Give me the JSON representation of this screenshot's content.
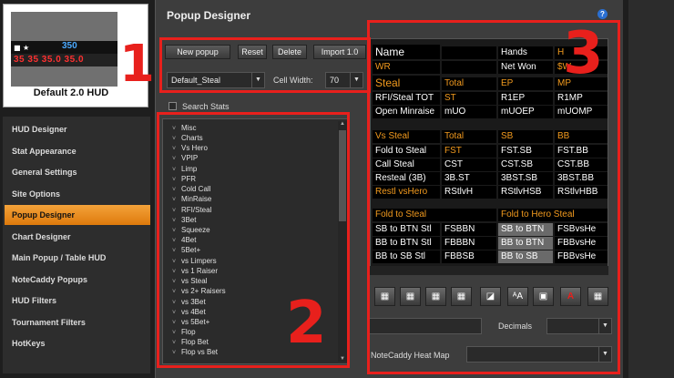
{
  "hud_preview": {
    "stat_value_top": "350",
    "stat_values_bottom": "35 35 35.0 35.0",
    "caption": "Default 2.0 HUD"
  },
  "sidebar": {
    "items": [
      {
        "label": "HUD Designer"
      },
      {
        "label": "Stat Appearance"
      },
      {
        "label": "General Settings"
      },
      {
        "label": "Site Options"
      },
      {
        "label": "Popup Designer"
      },
      {
        "label": "Chart Designer"
      },
      {
        "label": "Main Popup / Table HUD"
      },
      {
        "label": "NoteCaddy Popups"
      },
      {
        "label": "HUD Filters"
      },
      {
        "label": "Tournament Filters"
      },
      {
        "label": "HotKeys"
      }
    ],
    "active_index": 4
  },
  "panel": {
    "title": "Popup Designer",
    "help_icon": "?",
    "buttons": {
      "new_popup": "New popup",
      "reset": "Reset",
      "delete": "Delete",
      "import": "Import 1.0"
    },
    "popup_select": {
      "value": "Default_Steal"
    },
    "cell_width": {
      "label": "Cell Width:",
      "value": "70"
    },
    "search_stats": {
      "label": "Search Stats"
    },
    "decimals": {
      "label": "Decimals"
    },
    "heatmap": {
      "label": "NoteCaddy Heat Map"
    }
  },
  "stat_list": [
    "Misc",
    "Charts",
    "Vs Hero",
    "VPIP",
    "Limp",
    "PFR",
    "Cold Call",
    "MinRaise",
    "RFI/Steal",
    "3Bet",
    "Squeeze",
    "4Bet",
    "5Bet+",
    "vs Limpers",
    "vs 1 Raiser",
    "vs Steal",
    "vs 2+ Raisers",
    "vs 3Bet",
    "vs 4Bet",
    "vs 5Bet+",
    "Flop",
    "Flop Bet",
    "Flop vs Bet"
  ],
  "grid": {
    "rows": [
      [
        "Name",
        "",
        "Hands",
        "H"
      ],
      [
        "WR",
        "",
        "Net Won",
        "$W"
      ],
      [
        "Steal",
        "Total",
        "EP",
        "MP"
      ],
      [
        "RFI/Steal TOT",
        "ST",
        "R1EP",
        "R1MP"
      ],
      [
        "Open Minraise",
        "mUO",
        "mUOEP",
        "mUOMP"
      ],
      [
        "Vs Steal",
        "Total",
        "SB",
        "BB"
      ],
      [
        "Fold to Steal",
        "FST",
        "FST.SB",
        "FST.BB"
      ],
      [
        "Call Steal",
        "CST",
        "CST.SB",
        "CST.BB"
      ],
      [
        "Resteal (3B)",
        "3B.ST",
        "3BST.SB",
        "3BST.BB"
      ],
      [
        "Restl vsHero",
        "RStlvH",
        "RStlvHSB",
        "RStlvHBB"
      ],
      [
        "Fold to Steal",
        "",
        "Fold to Hero Steal",
        ""
      ],
      [
        "SB to BTN Stl",
        "FSBBN",
        "SB to BTN",
        "FSBvsHe"
      ],
      [
        "BB to BTN Stl",
        "FBBBN",
        "BB to BTN",
        "FBBvsHe"
      ],
      [
        "BB to SB Stl",
        "FBBSB",
        "BB to SB",
        "FBBvsHe"
      ]
    ]
  },
  "toolbar_icons": [
    "add-row-icon",
    "delete-row-icon",
    "add-column-icon",
    "delete-column-icon",
    "eraser-icon",
    "text-size-icon",
    "border-icon",
    "font-color-icon",
    "settings-icon"
  ],
  "toolbar_glyphs": [
    "▦",
    "▦",
    "▦",
    "▦",
    "◪",
    "ᴬA",
    "▣",
    "A",
    "▦"
  ],
  "annotations": {
    "one": "1",
    "two": "2",
    "three": "3",
    "color": "#e8201c"
  },
  "colors": {
    "accent_orange": "#f29a1e",
    "active_nav": "#e88a1c",
    "annotation_red": "#e8201c"
  }
}
